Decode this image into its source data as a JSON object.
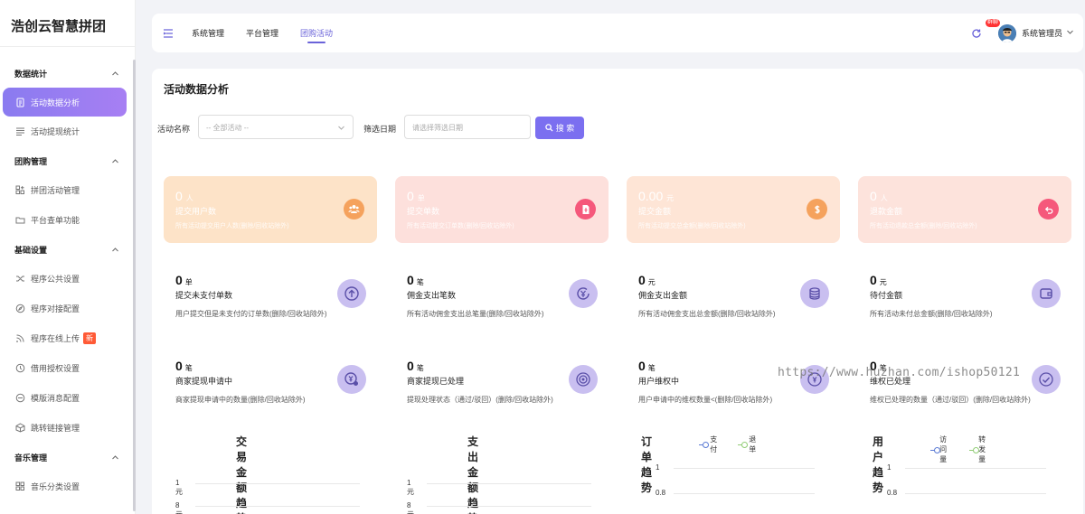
{
  "brand": "浩创云智慧拼团",
  "sidebar": {
    "groups": [
      {
        "title": "数据统计",
        "items": [
          {
            "label": "活动数据分析",
            "icon": "document-icon",
            "active": true
          },
          {
            "label": "活动提现统计",
            "icon": "list-icon"
          }
        ]
      },
      {
        "title": "团购管理",
        "items": [
          {
            "label": "拼团活动管理",
            "icon": "apps-icon"
          },
          {
            "label": "平台查单功能",
            "icon": "folder-icon"
          }
        ]
      },
      {
        "title": "基础设置",
        "items": [
          {
            "label": "程序公共设置",
            "icon": "shuffle-icon"
          },
          {
            "label": "程序对接配置",
            "icon": "compass-icon"
          },
          {
            "label": "程序在线上传",
            "icon": "rss-icon",
            "badge": "新"
          },
          {
            "label": "借用授权设置",
            "icon": "clock-icon"
          },
          {
            "label": "模版消息配置",
            "icon": "minus-circle-icon"
          },
          {
            "label": "跳转链接管理",
            "icon": "cube-icon"
          }
        ]
      },
      {
        "title": "音乐管理",
        "items": [
          {
            "label": "音乐分类设置",
            "icon": "grid-icon"
          }
        ]
      }
    ]
  },
  "topbar": {
    "tabs": [
      {
        "label": "系统管理"
      },
      {
        "label": "平台管理"
      },
      {
        "label": "团购活动",
        "active": true
      }
    ],
    "notification_badge": "群聊",
    "user_name": "系统管理员"
  },
  "panel": {
    "title": "活动数据分析",
    "filters": {
      "activity_label": "活动名称",
      "activity_value": "-- 全部活动 --",
      "date_label": "筛选日期",
      "date_placeholder": "请选择筛选日期",
      "search_button": "搜 索"
    },
    "big_cards": [
      {
        "value": "0",
        "unit": "人",
        "label": "提交用户数",
        "desc": "所有活动提交用户人数(删除/回收站除外)",
        "color": "#fde3c8",
        "icon_color": "#f5a25d",
        "icon": "users-icon"
      },
      {
        "value": "0",
        "unit": "单",
        "label": "提交单数",
        "desc": "所有活动提交订单数(删除/回收站除外)",
        "color": "#fde0dc",
        "icon_color": "#f5587b",
        "icon": "order-icon"
      },
      {
        "value": "0.00",
        "unit": "元",
        "label": "提交金额",
        "desc": "所有活动提交总金额(删除/回收站除外)",
        "color": "#fee5d6",
        "icon_color": "#f5a25d",
        "icon": "dollar-icon"
      },
      {
        "value": "0",
        "unit": "人",
        "label": "退款金额",
        "desc": "所有活动退款总金额(删除/回收站除外)",
        "color": "#fde3dc",
        "icon_color": "#f5587b",
        "icon": "undo-icon"
      }
    ],
    "stats": [
      {
        "value": "0",
        "unit": "单",
        "label": "提交未支付单数",
        "desc": "用户提交但是未支付的订单数(删除/回收站除外)",
        "icon": "upload-circle-icon"
      },
      {
        "value": "0",
        "unit": "笔",
        "label": "佣金支出笔数",
        "desc": "所有活动佣金支出总笔量(删除/回收站除外)",
        "icon": "yen-refresh-icon"
      },
      {
        "value": "0",
        "unit": "元",
        "label": "佣金支出金额",
        "desc": "所有活动佣金支出总金额(删除/回收站除外)",
        "icon": "coins-icon"
      },
      {
        "value": "0",
        "unit": "元",
        "label": "待付金额",
        "desc": "所有活动未付总金额(删除/回收站除外)",
        "icon": "wallet-icon"
      },
      {
        "value": "0",
        "unit": "笔",
        "label": "商家提现申请中",
        "desc": "商家提现申请中的数量(删除/回收站除外)",
        "icon": "yen-clock-icon"
      },
      {
        "value": "0",
        "unit": "笔",
        "label": "商家提现已处理",
        "desc": "提现处理状态（通过/驳回）(删除/回收站除外)",
        "icon": "target-icon"
      },
      {
        "value": "0",
        "unit": "笔",
        "label": "用户维权中",
        "desc": "用户申请中的维权数量<(删除/回收站除外)",
        "icon": "shield-icon"
      },
      {
        "value": "0",
        "unit": "笔",
        "label": "维权已处理",
        "desc": "维权已处理的数量（通过/驳回）(删除/回收站除外)",
        "icon": "check-circle-icon"
      }
    ]
  },
  "chart_data": [
    {
      "type": "line",
      "title": "交易金额趋势",
      "y_ticks": [
        "1 元",
        "8 元"
      ]
    },
    {
      "type": "line",
      "title": "支出金额趋势",
      "y_ticks": [
        "1 元",
        "8 元"
      ]
    },
    {
      "type": "line",
      "title": "订单趋势",
      "series": [
        {
          "name": "支付",
          "color": "#5b7bd5"
        },
        {
          "name": "退单",
          "color": "#91cc75"
        }
      ],
      "y_ticks": [
        "1",
        "0.8"
      ]
    },
    {
      "type": "line",
      "title": "用户趋势",
      "series": [
        {
          "name": "访问量",
          "color": "#5b7bd5"
        },
        {
          "name": "转发量",
          "color": "#91cc75"
        }
      ],
      "y_ticks": [
        "1",
        "0.8"
      ]
    }
  ],
  "watermark": "https://www.huzhan.com/ishop50121"
}
